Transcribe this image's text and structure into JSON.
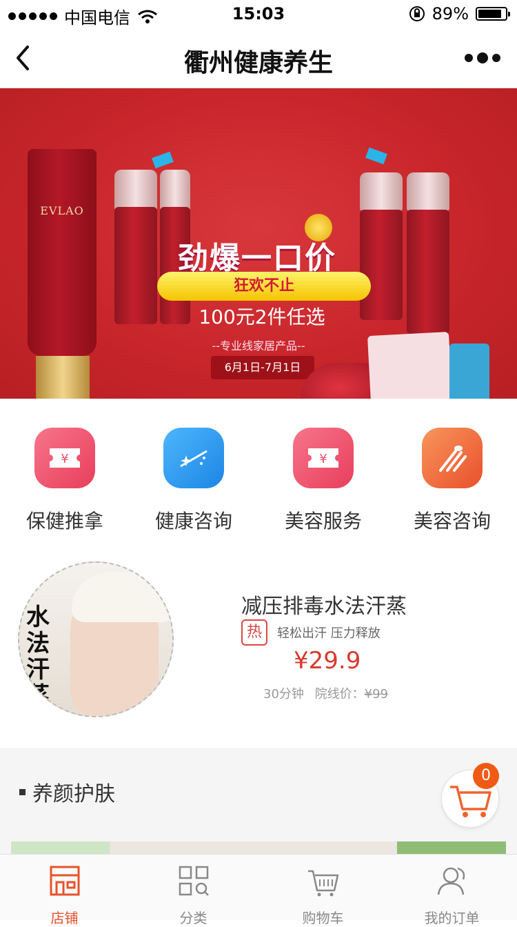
{
  "status_bar": {
    "carrier": "中国电信",
    "time": "15:03",
    "battery": "89%",
    "battery_level": 0.89
  },
  "nav": {
    "title": "衢州健康养生"
  },
  "banner": {
    "headline": "劲爆一口价",
    "badge": "狂欢不止",
    "offer": "100元2件任选",
    "subtitle": "--专业线家居产品--",
    "date": "6月1日-7月1日",
    "brand": "EVLAO",
    "dots": 3,
    "active_dot": 0
  },
  "categories": [
    {
      "label": "保健推拿",
      "icon": "ticket-icon",
      "color": "#f2566e"
    },
    {
      "label": "健康咨询",
      "icon": "sparkle-icon",
      "color": "#2a9cf0"
    },
    {
      "label": "美容服务",
      "icon": "ticket-icon",
      "color": "#f2566e"
    },
    {
      "label": "美容咨询",
      "icon": "brush-icon",
      "color": "#f26c3d"
    }
  ],
  "featured": {
    "title": "减压排毒水法汗蒸",
    "hot": "热",
    "tags": "轻松出汗 压力释放",
    "price": "¥29.9",
    "duration": "30分钟",
    "origin_label": "院线价：",
    "origin_price": "¥99",
    "image_tag": "汗蒸",
    "image_text": "水法汗蒸"
  },
  "section": {
    "title": "养颜护肤"
  },
  "cart": {
    "count": "0"
  },
  "tabs": [
    {
      "label": "店铺",
      "icon": "store-icon",
      "active": true
    },
    {
      "label": "分类",
      "icon": "category-icon",
      "active": false
    },
    {
      "label": "购物车",
      "icon": "cart-icon",
      "active": false
    },
    {
      "label": "我的订单",
      "icon": "user-icon",
      "active": false
    }
  ],
  "colors": {
    "accent": "#e8522a",
    "price": "#d8382e",
    "banner": "#c8262b"
  }
}
